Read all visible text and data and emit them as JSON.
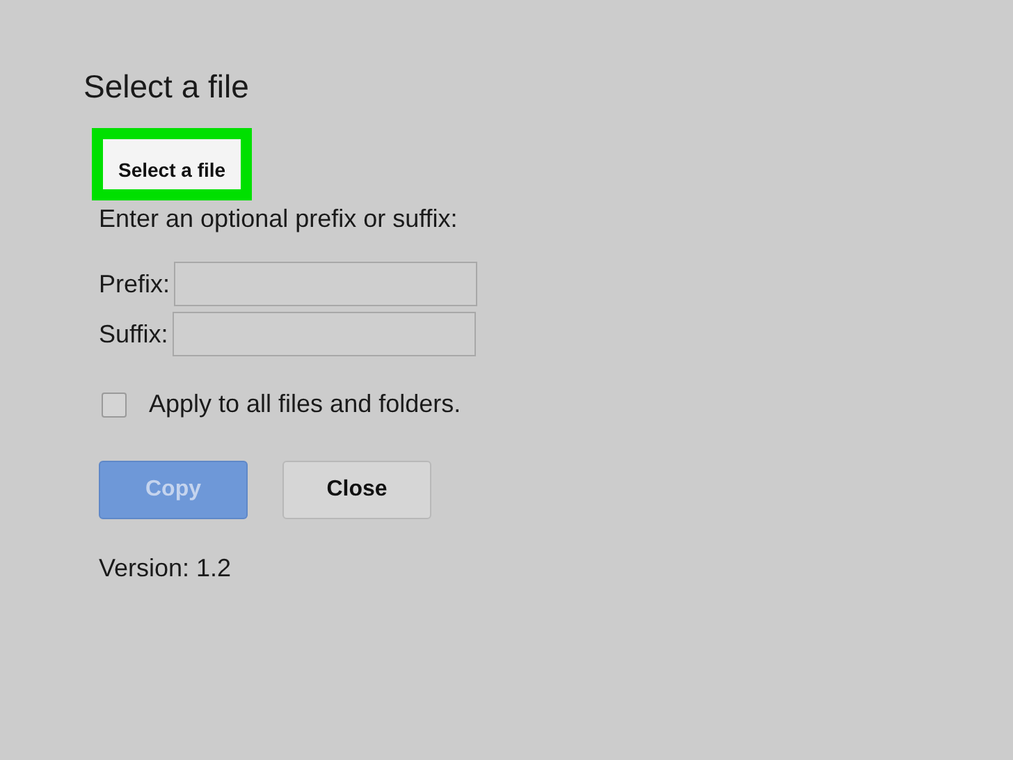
{
  "dialog": {
    "title": "Select a file",
    "select_button": {
      "label": "Select a file",
      "highlighted": true
    },
    "instructions": "Enter an optional prefix or suffix:",
    "fields": [
      {
        "label": "Prefix:"
      },
      {
        "label": "Suffix:"
      }
    ],
    "apply_all": {
      "label": "Apply to all files and folders.",
      "checked": false
    },
    "buttons": [
      {
        "label": "Copy",
        "kind": "primary",
        "disabled": true
      },
      {
        "label": "Close",
        "kind": "secondary",
        "disabled": false
      }
    ],
    "version": "Version: 1.2"
  }
}
